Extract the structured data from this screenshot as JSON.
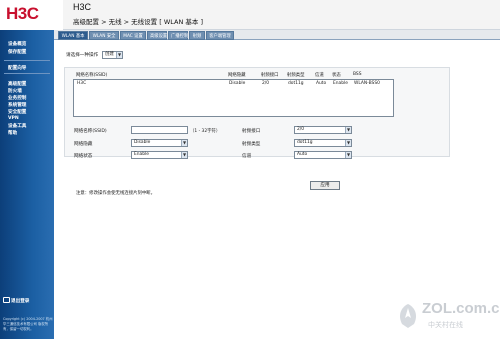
{
  "brand": {
    "logo": "H3C",
    "title": "H3C"
  },
  "breadcrumb": "高级配置 > 无线 > 无线设置 [ WLAN 基本 ]",
  "sidebar": {
    "items": [
      {
        "label": "设备概览"
      },
      {
        "label": "保存配置"
      },
      {
        "label": "配置向导"
      },
      {
        "label": "高级配置"
      },
      {
        "label": "防火墙"
      },
      {
        "label": "业务控制"
      },
      {
        "label": "系统管理"
      },
      {
        "label": "安全配置"
      },
      {
        "label": "VPN"
      },
      {
        "label": "设备工具"
      },
      {
        "label": "帮助"
      }
    ],
    "logout": "退出登录",
    "copyright": "Copyright (c) 2004-2007 杭州华三通信技术有限公司 版权所有，保留一切权利。"
  },
  "tabs": [
    {
      "label": "WLAN 基本"
    },
    {
      "label": "WLAN 安全"
    },
    {
      "label": "MAC 设置"
    },
    {
      "label": "高级设置"
    },
    {
      "label": "广播控制"
    },
    {
      "label": "射频"
    },
    {
      "label": "客户端管理"
    }
  ],
  "operation": {
    "label": "请选择一种操作",
    "value": "创建"
  },
  "list": {
    "columns": [
      "网络名称(SSID)",
      "网络隐藏",
      "射频接口",
      "射频类型",
      "信道",
      "状态",
      "BSS"
    ],
    "rows": [
      [
        "H3C",
        "Disable",
        "2/0",
        "dot11g",
        "Auto",
        "Enable",
        "WLAN-BSS0"
      ]
    ]
  },
  "form": {
    "ssid_label": "网络名称(SSID)",
    "ssid_value": "",
    "ssid_hint": "（1 - 32字符）",
    "hide_label": "网络隐藏",
    "hide_value": "Disable",
    "status_label": "网络状态",
    "status_value": "Enable",
    "iface_label": "射频接口",
    "iface_value": "2/0",
    "type_label": "射频类型",
    "type_value": "dot11g",
    "channel_label": "信道",
    "channel_value": "Auto",
    "apply": "应用",
    "note": "注意：修改操作会使无线连接片刻中断。"
  },
  "watermark": {
    "site": "ZOL.com.cn",
    "cn": "中关村在线"
  },
  "colors": {
    "brand_red": "#c8102e",
    "sidebar_blue": "#1b5fa3",
    "tab_active": "#2e5c8e"
  }
}
